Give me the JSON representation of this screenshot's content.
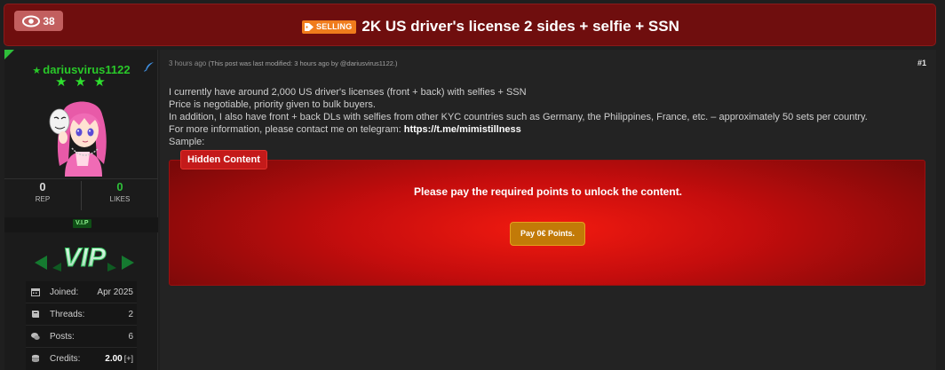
{
  "thread": {
    "views": "38",
    "tag_label": "SELLING",
    "title": "2K US driver's license 2 sides + selfie + SSN"
  },
  "user": {
    "username": "dariusvirus1122",
    "stars": "★ ★ ★",
    "rep_value": "0",
    "rep_label": "REP",
    "likes_value": "0",
    "likes_label": "LIKES",
    "vip_badge": "V.I.P",
    "vip_logo_text": "VIP",
    "info": [
      {
        "key": "Joined:",
        "value": "Apr 2025",
        "icon": "calendar-icon"
      },
      {
        "key": "Threads:",
        "value": "2",
        "icon": "book-icon"
      },
      {
        "key": "Posts:",
        "value": "6",
        "icon": "comments-icon"
      },
      {
        "key": "Credits:",
        "value": "2.00",
        "extra": "[+]",
        "icon": "coins-icon"
      }
    ]
  },
  "post": {
    "time": "3 hours ago",
    "modified_note": "(This post was last modified: 3 hours ago by @dariusvirus1122.)",
    "number": "#1",
    "lines": [
      "I currently have around 2,000 US driver's licenses (front + back) with selfies + SSN",
      "Price is negotiable, priority given to bulk buyers.",
      "In addition, I also have front + back DLs with selfies from other KYC countries such as Germany, the Philippines, France, etc. – approximately 50 sets per country.",
      "For more information, please contact me on telegram: "
    ],
    "contact_link": "https://t.me/mimistillness",
    "sample_label": "Sample:",
    "hidden": {
      "label": "Hidden Content",
      "message": "Please pay the required points to unlock the content.",
      "button": "Pay 0€ Points."
    }
  },
  "colors": {
    "title_bar": "#6f0e0e",
    "selling_tag": "#f07c1c",
    "username": "#29c829",
    "hidden_box": "#c50d0d",
    "pay_button": "#c27a08"
  }
}
